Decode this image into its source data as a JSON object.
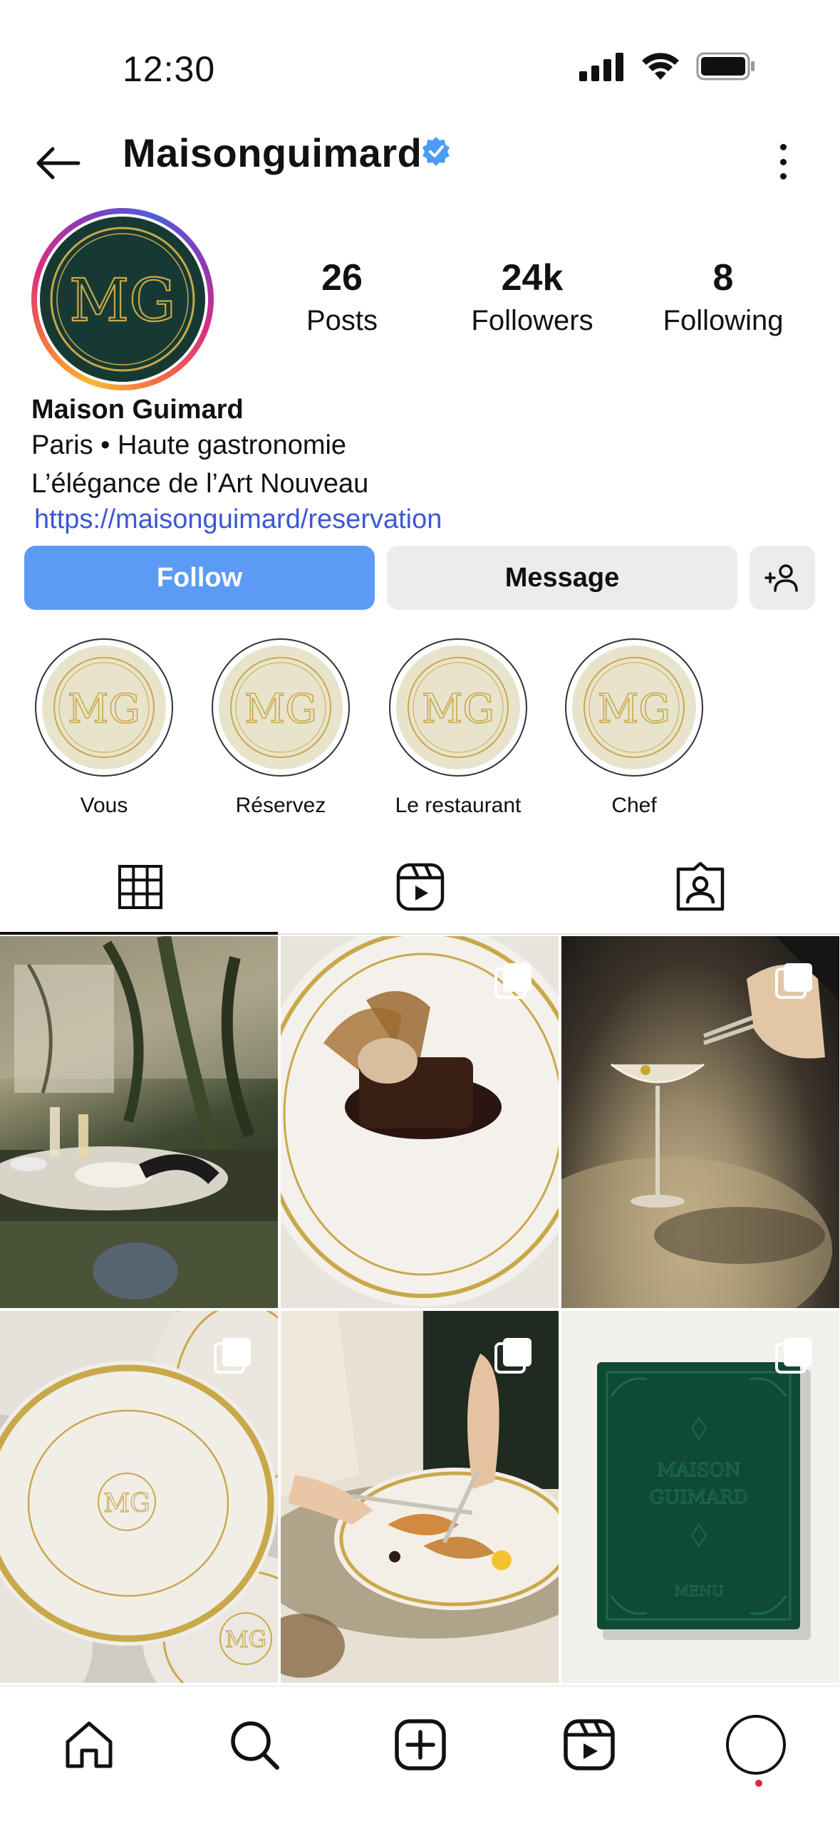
{
  "status_bar": {
    "time": "12:30"
  },
  "header": {
    "username": "Maisonguimard"
  },
  "profile": {
    "avatar_monogram": "MG",
    "stats": [
      {
        "value": "26",
        "label": "Posts"
      },
      {
        "value": "24k",
        "label": "Followers"
      },
      {
        "value": "8",
        "label": "Following"
      }
    ],
    "display_name": "Maison Guimard",
    "bio_line_1": "Paris • Haute gastronomie",
    "bio_line_2": "L’élégance de l’Art Nouveau",
    "link": "https://maisonguimard/reservation"
  },
  "actions": {
    "follow_label": "Follow",
    "message_label": "Message"
  },
  "highlights": [
    {
      "label": "Vous"
    },
    {
      "label": "Réservez"
    },
    {
      "label": "Le restaurant"
    },
    {
      "label": "Chef"
    }
  ],
  "tabs": [
    {
      "icon": "grid-icon",
      "active": true
    },
    {
      "icon": "reels-icon",
      "active": false
    },
    {
      "icon": "tagged-icon",
      "active": false
    }
  ],
  "posts": [
    {
      "subject": "restaurant-dining-room"
    },
    {
      "subject": "chocolate-dessert-plate"
    },
    {
      "subject": "cocktail-glass"
    },
    {
      "subject": "monogram-plates"
    },
    {
      "subject": "fish-dish-plating"
    },
    {
      "subject": "green-menu-book"
    }
  ],
  "menu_book": {
    "title_1": "MAISON",
    "title_2": "GUIMARD",
    "subtitle": "MENU"
  },
  "colors": {
    "follow_blue": "#5b9bf5",
    "verified_blue": "#4c9bf5",
    "link_blue": "#3a57d8",
    "avatar_green": "#163a33",
    "gold": "#c9a84a"
  }
}
